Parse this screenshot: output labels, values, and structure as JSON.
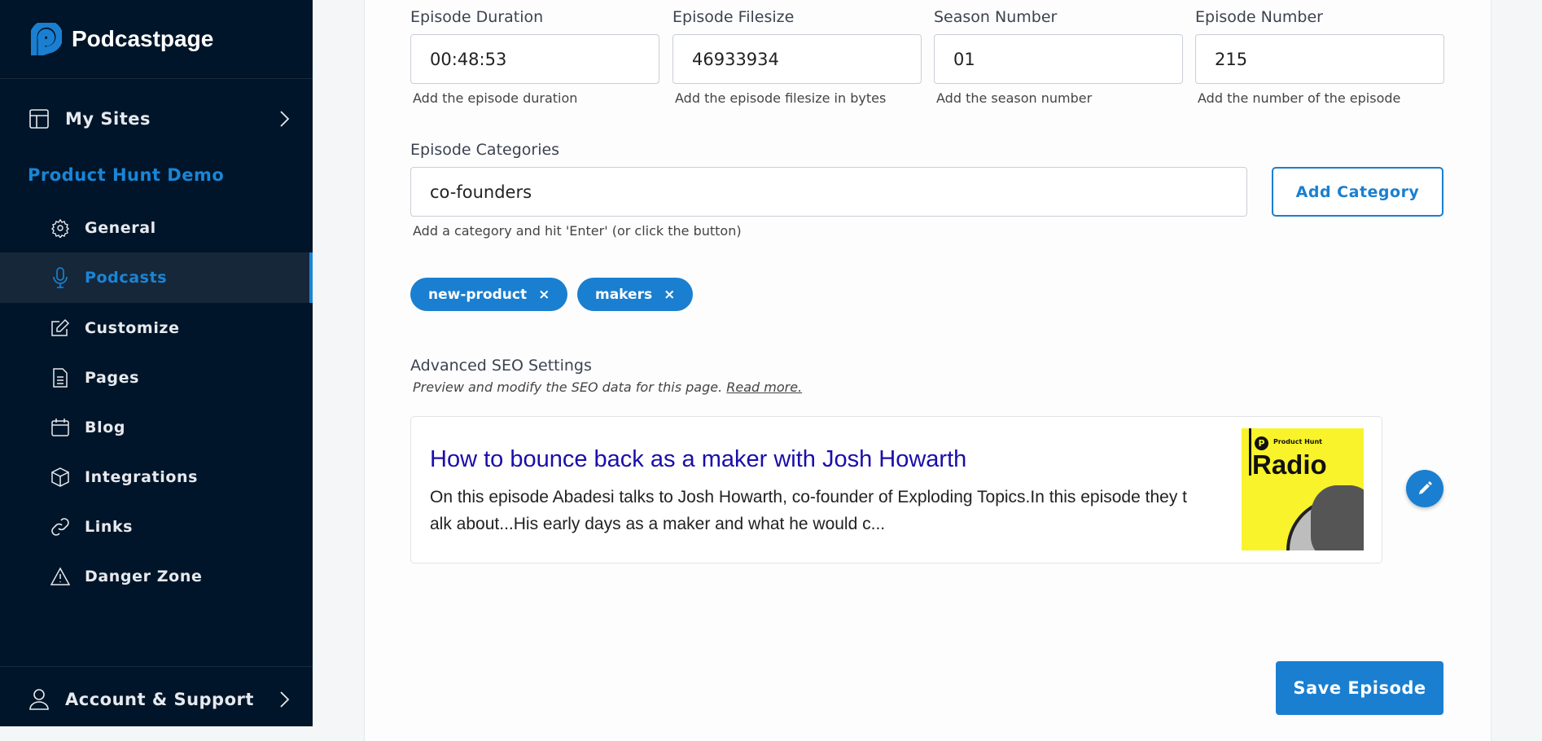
{
  "sidebar": {
    "brand": "Podcastpage",
    "my_sites": "My Sites",
    "site_name": "Product Hunt Demo",
    "items": [
      {
        "label": "General",
        "icon": "gear-icon"
      },
      {
        "label": "Podcasts",
        "icon": "microphone-icon"
      },
      {
        "label": "Customize",
        "icon": "edit-icon"
      },
      {
        "label": "Pages",
        "icon": "document-icon"
      },
      {
        "label": "Blog",
        "icon": "calendar-icon"
      },
      {
        "label": "Integrations",
        "icon": "cube-icon"
      },
      {
        "label": "Links",
        "icon": "link-icon"
      },
      {
        "label": "Danger Zone",
        "icon": "warning-icon"
      }
    ],
    "active": "Podcasts",
    "account": "Account & Support",
    "accent": "#1a85d6"
  },
  "form": {
    "fields": [
      {
        "label": "Episode Duration",
        "value": "00:48:53",
        "help": "Add the episode duration"
      },
      {
        "label": "Episode Filesize",
        "value": "46933934",
        "help": "Add the episode filesize in bytes"
      },
      {
        "label": "Season Number",
        "value": "01",
        "help": "Add the season number"
      },
      {
        "label": "Episode Number",
        "value": "215",
        "help": "Add the number of the episode"
      }
    ],
    "categories": {
      "label": "Episode Categories",
      "value": "co-founders",
      "help": "Add a category and hit 'Enter' (or click the button)",
      "button": "Add Category",
      "tags": [
        "new-product",
        "makers"
      ]
    },
    "seo": {
      "label": "Advanced SEO Settings",
      "subtitle": "Preview and modify the SEO data for this page.",
      "read_more": "Read more.",
      "title": "How to bounce back as a maker with Josh Howarth",
      "description": "On this episode Abadesi talks to Josh Howarth, co-founder of Exploding Topics.In this episode they talk about...His early days as a maker and what he would c...",
      "image_brand": "Product Hunt",
      "image_title": "Radio"
    },
    "save": "Save Episode"
  }
}
